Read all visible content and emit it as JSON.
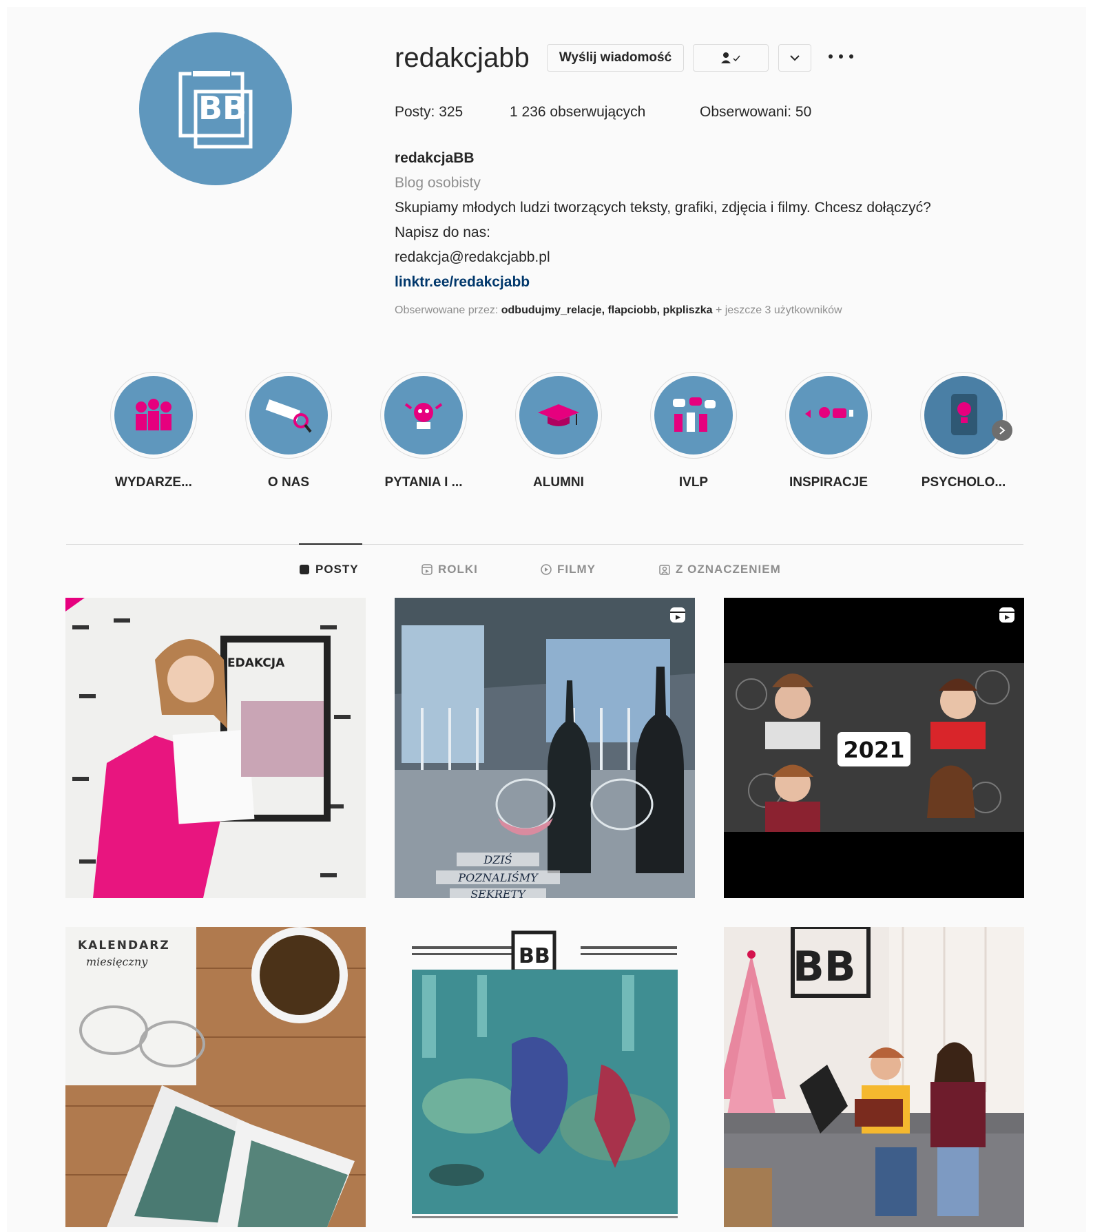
{
  "profile": {
    "username": "redakcjabb",
    "buttons": {
      "message": "Wyślij wiadomość"
    },
    "stats": {
      "posts": "Posty: 325",
      "followers": "1 236 obserwujących",
      "following": "Obserwowani: 50"
    },
    "bio": {
      "name": "redakcjaBB",
      "category": "Blog osobisty",
      "line1": "Skupiamy młodych ludzi tworzących teksty, grafiki, zdjęcia i filmy. Chcesz dołączyć?",
      "line2": "Napisz do nas:",
      "email": "redakcja@redakcjabb.pl",
      "link": "linktr.ee/redakcjabb"
    },
    "followed_by": {
      "prefix": "Obserwowane przez:",
      "users": "odbudujmy_relacje, flapciobb, pkpliszka",
      "suffix": "+ jeszcze 3 użytkowników"
    },
    "colors": {
      "accent": "#5f97bd",
      "pink": "#e6007e"
    }
  },
  "highlights": [
    {
      "label": "WYDARZE...",
      "icon": "people-icon"
    },
    {
      "label": "O NAS",
      "icon": "magnifier-icon"
    },
    {
      "label": "PYTANIA I ...",
      "icon": "robot-icon"
    },
    {
      "label": "ALUMNI",
      "icon": "graduation-cap-icon"
    },
    {
      "label": "IVLP",
      "icon": "group-chat-icon"
    },
    {
      "label": "INSPIRACJE",
      "icon": "lightbulb-icon"
    },
    {
      "label": "PSYCHOLO...",
      "icon": "tablet-icon"
    }
  ],
  "tabs": [
    {
      "label": "POSTY",
      "icon": "grid-icon",
      "active": true
    },
    {
      "label": "ROLKI",
      "icon": "reels-icon",
      "active": false
    },
    {
      "label": "FILMY",
      "icon": "video-icon",
      "active": false
    },
    {
      "label": "Z OZNACZENIEM",
      "icon": "tagged-icon",
      "active": false
    }
  ],
  "posts": [
    {
      "kind": "photo",
      "overlay_text": "EDAKCJA"
    },
    {
      "kind": "reel",
      "overlay_lines": [
        "DZIŚ",
        "POZNALIŚMY",
        "SEKRETY"
      ]
    },
    {
      "kind": "reel",
      "overlay_text": "2021"
    },
    {
      "kind": "photo",
      "overlay_lines": [
        "KALENDARZ",
        "miesięczny"
      ]
    },
    {
      "kind": "photo"
    },
    {
      "kind": "photo"
    }
  ]
}
